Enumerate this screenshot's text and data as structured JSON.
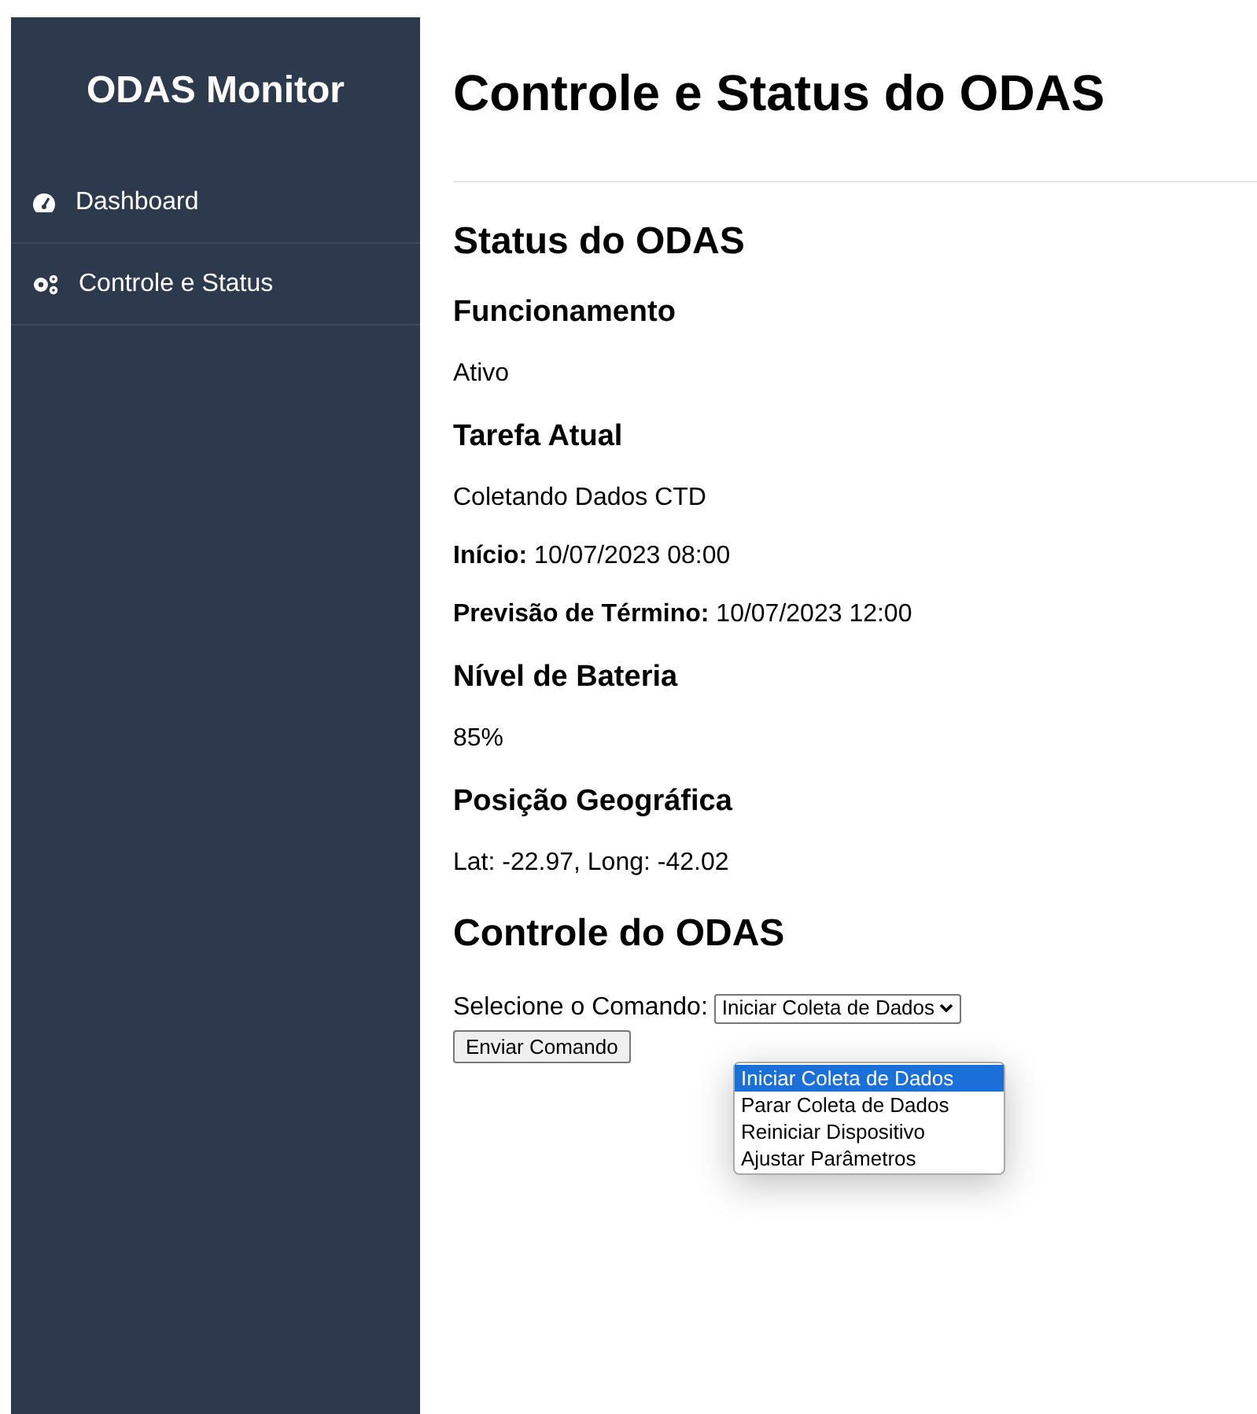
{
  "sidebar": {
    "title": "ODAS Monitor",
    "items": [
      {
        "label": "Dashboard",
        "kind": "gauge",
        "selected": false
      },
      {
        "label": "Controle e Status",
        "kind": "gears",
        "selected": false
      }
    ]
  },
  "page_title": "Controle e Status do ODAS",
  "status": {
    "heading": "Status do ODAS",
    "sections": [
      {
        "heading": "Funcionamento",
        "lines": [
          "Ativo"
        ]
      },
      {
        "heading": "Tarefa Atual",
        "lines": [
          "Coletando Dados CTD",
          "**Início:** 10/07/2023 08:00",
          "**Previsão de Término:** 10/07/2023 12:00"
        ]
      },
      {
        "heading": "Nível de Bateria",
        "lines": [
          "85%"
        ]
      },
      {
        "heading": "Posição Geográfica",
        "lines": [
          "Lat: -22.97, Long: -42.02"
        ]
      }
    ]
  },
  "control": {
    "heading": "Controle do ODAS",
    "label": "Selecione o Comando:",
    "select_value": "Iniciar Coleta de Dados",
    "options": [
      {
        "label": "Iniciar Coleta de Dados",
        "selected": true
      },
      {
        "label": "Parar Coleta de Dados",
        "selected": false
      },
      {
        "label": "Reiniciar Dispositivo",
        "selected": false
      },
      {
        "label": "Ajustar Parâmetros",
        "selected": false
      }
    ],
    "button": "Enviar Comando"
  }
}
